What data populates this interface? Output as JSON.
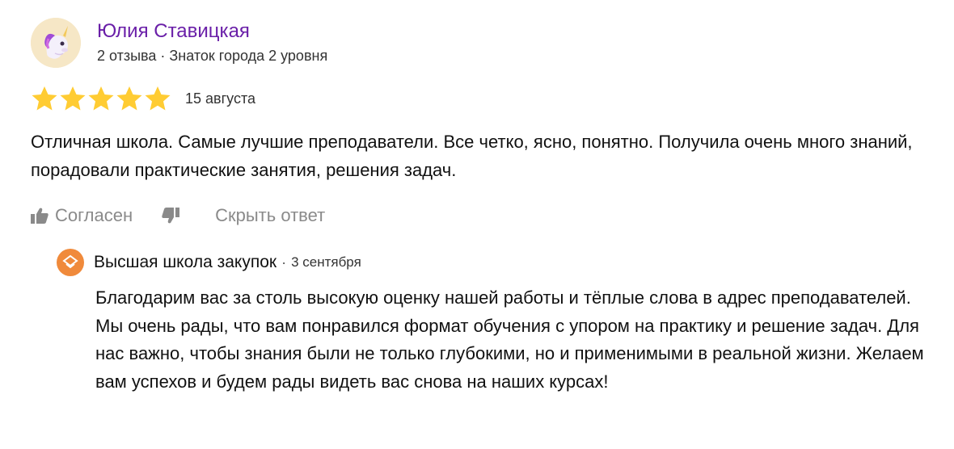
{
  "review": {
    "author": {
      "name": "Юлия Ставицкая",
      "meta": "2 отзыва · Знаток города 2 уровня",
      "avatar_icon": "unicorn-icon"
    },
    "rating": {
      "value": 5,
      "max": 5,
      "color": "#fc3"
    },
    "date": "15 августа",
    "text": "Отличная школа. Самые лучшие преподаватели. Все четко, ясно, понятно. Получила очень много знаний, порадовали практические занятия, решения задач.",
    "actions": {
      "agree_label": "Согласен",
      "hide_reply_label": "Скрыть ответ"
    }
  },
  "reply": {
    "org_name": "Высшая школа закупок",
    "separator": "·",
    "date": "3 сентября",
    "text": "Благодарим вас за столь высокую оценку нашей работы и тёплые слова в адрес преподавателей. Мы очень рады, что вам понравился формат обучения с упором на практику и решение задач. Для нас важно, чтобы знания были не только глубокими, но и применимыми в реальной жизни. Желаем вам успехов и будем рады видеть вас снова на наших курсах!",
    "accent_color": "#f08a3b"
  }
}
